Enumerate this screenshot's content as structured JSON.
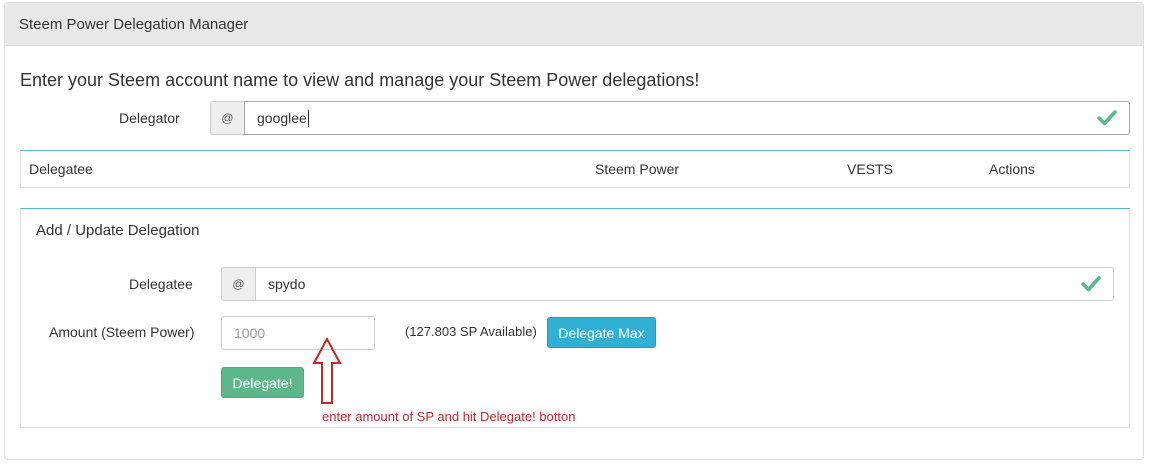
{
  "panel": {
    "title": "Steem Power Delegation Manager"
  },
  "intro_text": "Enter your Steem account name to view and manage your Steem Power delegations!",
  "delegator": {
    "label": "Delegator",
    "prefix": "@",
    "value": "googlee",
    "status_icon": "check-icon"
  },
  "table": {
    "headers": [
      "Delegatee",
      "Steem Power",
      "VESTS",
      "Actions"
    ]
  },
  "form": {
    "title": "Add / Update Delegation",
    "delegatee": {
      "label": "Delegatee",
      "prefix": "@",
      "value": "spydo",
      "status_icon": "check-icon"
    },
    "amount": {
      "label": "Amount (Steem Power)",
      "placeholder": "1000",
      "available": "(127.803 SP Available)"
    },
    "delegate_max_label": "Delegate Max",
    "delegate_label": "Delegate!"
  },
  "annotation": {
    "text": "enter amount of SP and hit Delegate! botton",
    "icon": "up-arrow-outline-icon"
  },
  "colors": {
    "check": "#5cb88a",
    "info_button": "#31b0d5",
    "success_button": "#5cb88a",
    "annotation": "#c0282a",
    "accent_border": "#5bb6c8"
  }
}
